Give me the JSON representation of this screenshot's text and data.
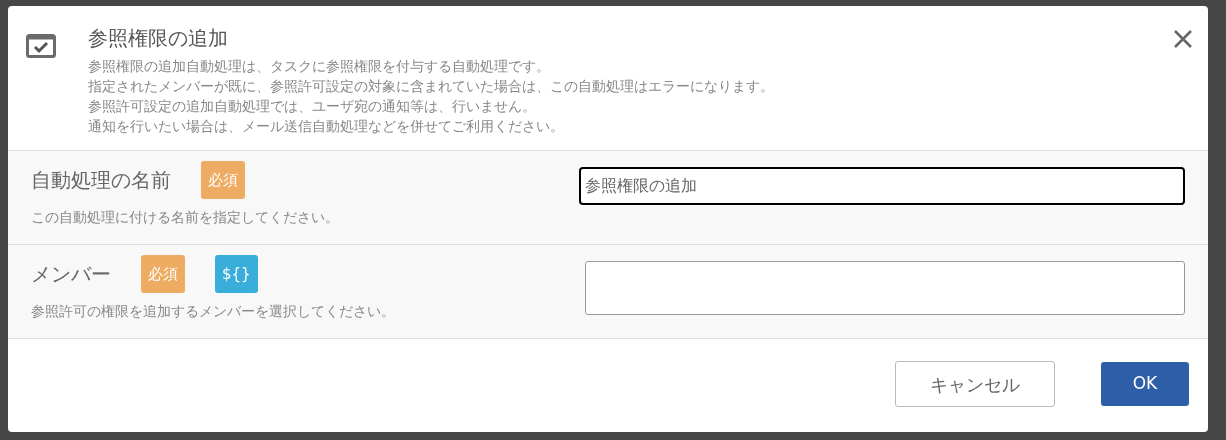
{
  "dialog": {
    "title": "参照権限の追加",
    "description": [
      "参照権限の追加自動処理は、タスクに参照権限を付与する自動処理です。",
      "指定されたメンバーが既に、参照許可設定の対象に含まれていた場合は、この自動処理はエラーになります。",
      "参照許可設定の追加自動処理では、ユーザ宛の通知等は、行いません。",
      "通知を行いたい場合は、メール送信自動処理などを併せてご利用ください。"
    ]
  },
  "fields": [
    {
      "label": "自動処理の名前",
      "badges": [
        {
          "kind": "required",
          "text": "必須"
        }
      ],
      "help": "この自動処理に付ける名前を指定してください。",
      "value": "参照権限の追加",
      "focused": true
    },
    {
      "label": "メンバー",
      "badges": [
        {
          "kind": "required",
          "text": "必須"
        },
        {
          "kind": "variable",
          "text": "${}"
        }
      ],
      "help": "参照許可の権限を追加するメンバーを選択してください。",
      "focused": false
    }
  ],
  "buttons": [
    {
      "kind": "secondary",
      "label": "キャンセル"
    },
    {
      "kind": "primary",
      "label": "OK"
    }
  ]
}
